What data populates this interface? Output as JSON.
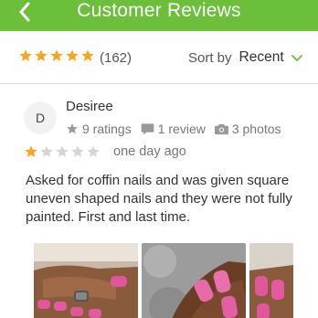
{
  "header": {
    "title": "Customer Reviews",
    "back_icon": "chevron-left-icon",
    "background": "#6cbf3a"
  },
  "summary": {
    "rating": 5,
    "review_count": "(162)",
    "sort_label": "Sort by",
    "sort_value": "Recent",
    "star_color": "#f5a623"
  },
  "review": {
    "avatar_initial": "D",
    "name": "Desiree",
    "ratings_text": "9 ratings",
    "reviews_text": "1 review",
    "photos_text": "3 photos",
    "rating": 1,
    "date": "one day ago",
    "text": "Asked for coffin nails and was given square uneven shaped nails and they were not fully painted. First and last time.",
    "photos": [
      "nail-photo-1",
      "nail-photo-2",
      "nail-photo-3"
    ]
  }
}
